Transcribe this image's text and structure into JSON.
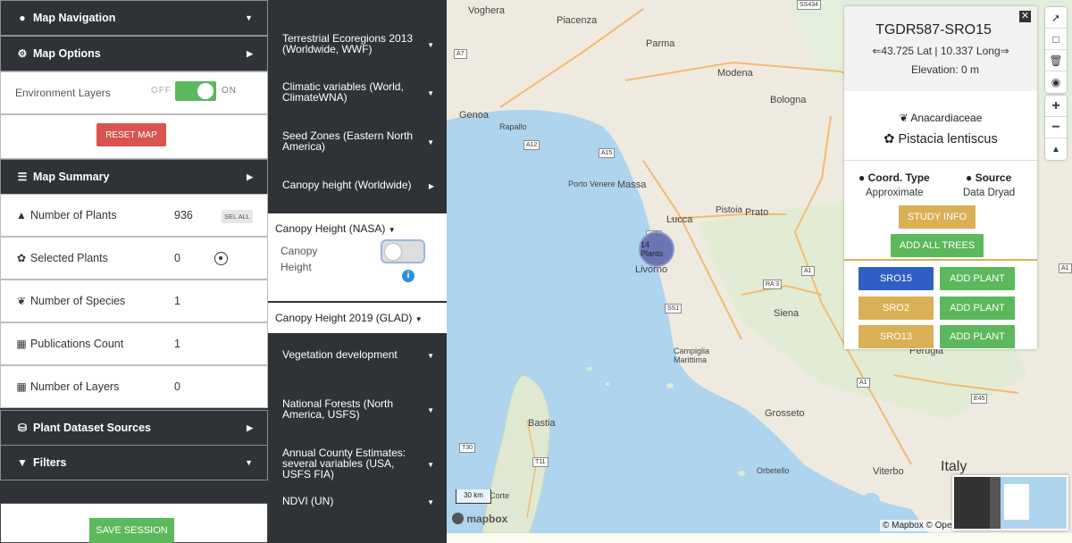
{
  "sidebar": {
    "map_navigation": "Map Navigation",
    "map_options": "Map Options",
    "env_layers_label": "Environment Layers",
    "toggle_off": "OFF",
    "toggle_on": "ON",
    "reset_map": "RESET MAP",
    "map_summary": "Map Summary",
    "summary_rows": [
      {
        "label": "Number of Plants",
        "value": "936"
      },
      {
        "label": "Selected Plants",
        "value": "0"
      },
      {
        "label": "Number of Species",
        "value": "1"
      },
      {
        "label": "Publications Count",
        "value": "1"
      },
      {
        "label": "Number of Layers",
        "value": "0"
      }
    ],
    "sel_all": "SEL ALL",
    "plant_dataset_sources": "Plant Dataset Sources",
    "filters": "Filters",
    "save_session": "SAVE SESSION"
  },
  "layers": {
    "items": [
      "Terrestrial Ecoregions 2013 (Worldwide, WWF)",
      "Climatic variables (World, ClimateWNA)",
      "Seed Zones (Eastern North America)",
      "Canopy height (Worldwide)"
    ],
    "canopy_nasa_title": "Canopy Height (NASA)",
    "canopy_nasa_toggle_label": "Canopy Height",
    "canopy_glad_title": "Canopy Height 2019 (GLAD)",
    "items2": [
      "Vegetation development",
      "National Forests (North America, USFS)",
      "Annual County Estimates: several variables (USA, USFS FIA)",
      "NDVI (UN)"
    ]
  },
  "map": {
    "places": {
      "voghera": "Voghera",
      "piacenza": "Piacenza",
      "parma": "Parma",
      "modena": "Modena",
      "bologna": "Bologna",
      "genoa": "Genoa",
      "rapallo": "Rapallo",
      "porto_venere": "Porto Venere",
      "massa": "Massa",
      "lucca": "Lucca",
      "pistoia": "Pistoia",
      "prato": "Prato",
      "livorno": "Livorno",
      "siena": "Siena",
      "campiglia": "Campiglia Marittima",
      "grosseto": "Grosseto",
      "bastia": "Bastia",
      "orbetello": "Orbetello",
      "viterbo": "Viterbo",
      "perugia": "Perugia",
      "italy": "Italy",
      "corte": "Corte"
    },
    "roads": [
      "A7",
      "A12",
      "A15",
      "A1",
      "A11",
      "RA 3",
      "SS1",
      "A1",
      "E45",
      "T30",
      "T11",
      "SS434",
      "A1"
    ],
    "cluster_label": "14 Plants",
    "scale": "30 km",
    "attribution": "© Mapbox © Ope",
    "logo": "mapbox"
  },
  "popup": {
    "title": "TGDR587-SRO15",
    "coords": "43.725 Lat | 10.337 Long",
    "elevation": "Elevation: 0 m",
    "family": "Anacardiaceae",
    "species": "Pistacia lentiscus",
    "coord_type_label": "Coord. Type",
    "coord_type_value": "Approximate",
    "source_label": "Source",
    "source_value": "Data Dryad",
    "study_info": "STUDY INFO",
    "add_all_trees": "ADD ALL TREES",
    "plants": [
      {
        "id": "SRO15",
        "color": "#2f5fc4"
      },
      {
        "id": "SRO2",
        "color": "#d9b055"
      },
      {
        "id": "SRO13",
        "color": "#d9b055"
      }
    ],
    "add_plant": "ADD PLANT"
  },
  "colors": {
    "green": "#5cb85c",
    "red": "#d9534f",
    "gold": "#d9b055",
    "blue": "#2f5fc4",
    "dark": "#2f3338",
    "sea": "#aed4ee"
  }
}
